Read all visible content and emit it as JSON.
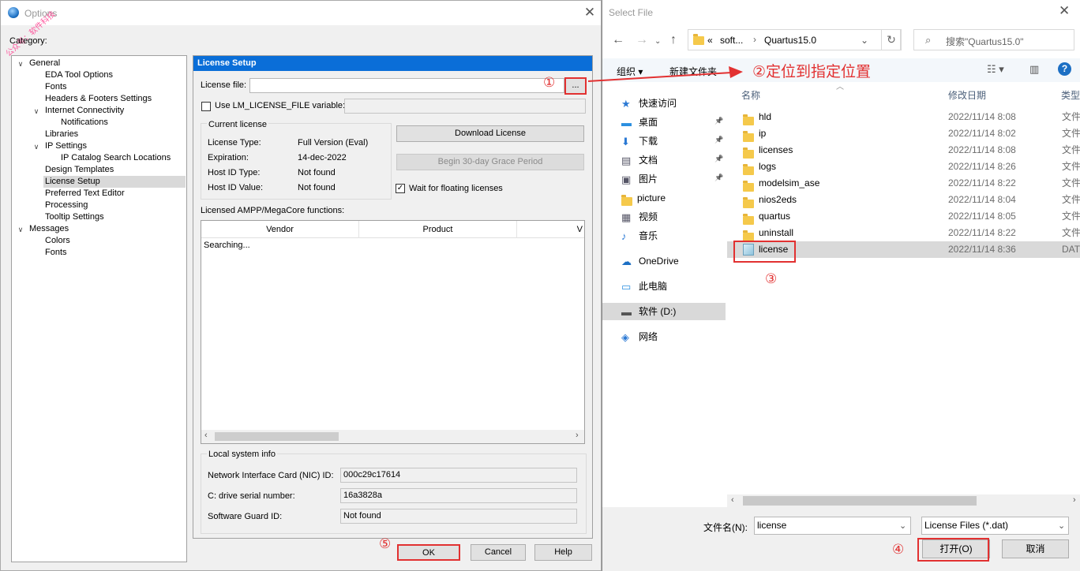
{
  "options_window": {
    "title": "Options",
    "watermark": "公众号：软件科技",
    "category_label": "Category:",
    "tree": [
      {
        "label": "General",
        "level": 0,
        "expanded": true
      },
      {
        "label": "EDA Tool Options",
        "level": 1
      },
      {
        "label": "Fonts",
        "level": 1
      },
      {
        "label": "Headers & Footers Settings",
        "level": 1
      },
      {
        "label": "Internet Connectivity",
        "level": 1,
        "expanded": true
      },
      {
        "label": "Notifications",
        "level": 2
      },
      {
        "label": "Libraries",
        "level": 1
      },
      {
        "label": "IP Settings",
        "level": 1,
        "expanded": true
      },
      {
        "label": "IP Catalog Search Locations",
        "level": 2
      },
      {
        "label": "Design Templates",
        "level": 1
      },
      {
        "label": "License Setup",
        "level": 1,
        "selected": true
      },
      {
        "label": "Preferred Text Editor",
        "level": 1
      },
      {
        "label": "Processing",
        "level": 1
      },
      {
        "label": "Tooltip Settings",
        "level": 1
      },
      {
        "label": "Messages",
        "level": 0,
        "expanded": true
      },
      {
        "label": "Colors",
        "level": 1
      },
      {
        "label": "Fonts",
        "level": 1
      }
    ],
    "license_setup": {
      "heading": "License Setup",
      "license_file_label": "License file:",
      "license_file_value": "",
      "browse_label": "...",
      "use_env_label": "Use LM_LICENSE_FILE variable:",
      "use_env_checked": false,
      "current_license_title": "Current license",
      "rows": [
        {
          "key": "License Type:",
          "value": "Full Version (Eval)"
        },
        {
          "key": "Expiration:",
          "value": "14-dec-2022"
        },
        {
          "key": "Host ID Type:",
          "value": "Not found"
        },
        {
          "key": "Host ID Value:",
          "value": "Not found"
        }
      ],
      "download_button": "Download License",
      "grace_button": "Begin 30-day Grace Period",
      "wait_floating_label": "Wait for floating licenses",
      "wait_floating_checked": true,
      "amp_label": "Licensed AMPP/MegaCore functions:",
      "amp_columns": [
        "Vendor",
        "Product",
        "V"
      ],
      "amp_status": "Searching...",
      "local_info_title": "Local system info",
      "nic_label": "Network Interface Card (NIC) ID:",
      "nic_value": "000c29c17614",
      "serial_label": "C: drive serial number:",
      "serial_value": "16a3828a",
      "guard_label": "Software Guard ID:",
      "guard_value": "Not found"
    },
    "ok_button": "OK",
    "cancel_button": "Cancel",
    "help_button": "Help"
  },
  "select_file": {
    "title": "Select File",
    "breadcrumb_prefix": "«",
    "breadcrumb": [
      "soft...",
      "Quartus15.0"
    ],
    "search_placeholder": "搜索\"Quartus15.0\"",
    "organize": "组织 ▾",
    "new_folder": "新建文件夹",
    "nav": [
      {
        "label": "快速访问",
        "icon": "star-icon",
        "pinned": false
      },
      {
        "label": "桌面",
        "icon": "desktop-icon",
        "pinned": true
      },
      {
        "label": "下载",
        "icon": "download-icon",
        "pinned": true
      },
      {
        "label": "文档",
        "icon": "document-icon",
        "pinned": true
      },
      {
        "label": "图片",
        "icon": "picture-icon",
        "pinned": true
      },
      {
        "label": "picture",
        "icon": "folder-icon",
        "pinned": false
      },
      {
        "label": "视频",
        "icon": "video-icon",
        "pinned": false
      },
      {
        "label": "音乐",
        "icon": "music-icon",
        "pinned": false
      },
      {
        "label": "OneDrive",
        "icon": "cloud-icon",
        "pinned": false
      },
      {
        "label": "此电脑",
        "icon": "computer-icon",
        "pinned": false
      },
      {
        "label": "软件 (D:)",
        "icon": "drive-icon",
        "pinned": false,
        "selected": true
      },
      {
        "label": "网络",
        "icon": "network-icon",
        "pinned": false
      }
    ],
    "columns": [
      "名称",
      "修改日期",
      "类型"
    ],
    "files": [
      {
        "name": "hld",
        "date": "2022/11/14 8:08",
        "type": "文件",
        "kind": "folder"
      },
      {
        "name": "ip",
        "date": "2022/11/14 8:02",
        "type": "文件",
        "kind": "folder"
      },
      {
        "name": "licenses",
        "date": "2022/11/14 8:08",
        "type": "文件",
        "kind": "folder"
      },
      {
        "name": "logs",
        "date": "2022/11/14 8:26",
        "type": "文件",
        "kind": "folder"
      },
      {
        "name": "modelsim_ase",
        "date": "2022/11/14 8:22",
        "type": "文件",
        "kind": "folder"
      },
      {
        "name": "nios2eds",
        "date": "2022/11/14 8:04",
        "type": "文件",
        "kind": "folder"
      },
      {
        "name": "quartus",
        "date": "2022/11/14 8:05",
        "type": "文件",
        "kind": "folder"
      },
      {
        "name": "uninstall",
        "date": "2022/11/14 8:22",
        "type": "文件",
        "kind": "folder"
      },
      {
        "name": "license",
        "date": "2022/11/14 8:36",
        "type": "DAT",
        "kind": "file",
        "selected": true
      }
    ],
    "filename_label": "文件名(N):",
    "filename_value": "license",
    "filter": "License Files (*.dat)",
    "open_button": "打开(O)",
    "cancel_button": "取消"
  },
  "annotations": {
    "step1": "①",
    "step2": "②定位到指定位置",
    "step3": "③",
    "step4": "④",
    "step5": "⑤",
    "color": "#e23131"
  }
}
